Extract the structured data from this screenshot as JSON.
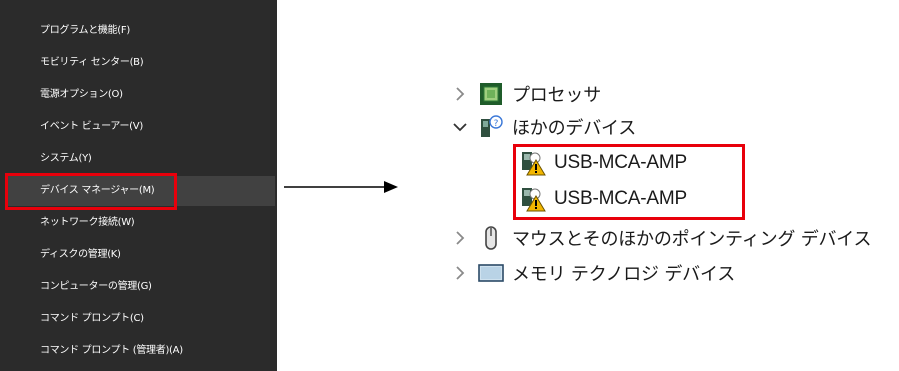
{
  "context_menu": {
    "items": [
      {
        "label": "プログラムと機能(F)"
      },
      {
        "label": "モビリティ センター(B)"
      },
      {
        "label": "電源オプション(O)"
      },
      {
        "label": "イベント ビューアー(V)"
      },
      {
        "label": "システム(Y)"
      },
      {
        "label": "デバイス マネージャー(M)"
      },
      {
        "label": "ネットワーク接続(W)"
      },
      {
        "label": "ディスクの管理(K)"
      },
      {
        "label": "コンピューターの管理(G)"
      },
      {
        "label": "コマンド プロンプト(C)"
      },
      {
        "label": "コマンド プロンプト (管理者)(A)"
      }
    ],
    "highlighted_item": "デバイス マネージャー(M)"
  },
  "device_tree": {
    "processors": {
      "label": "プロセッサ",
      "icon": "processor-icon"
    },
    "other_devices": {
      "label": "ほかのデバイス",
      "icon": "unknown-device-icon",
      "children": [
        {
          "label": "USB-MCA-AMP",
          "icon": "warning-device-icon"
        },
        {
          "label": "USB-MCA-AMP",
          "icon": "warning-device-icon"
        }
      ]
    },
    "mice": {
      "label": "マウスとそのほかのポインティング デバイス",
      "icon": "mouse-icon"
    },
    "memory": {
      "label": "メモリ テクノロジ デバイス",
      "icon": "memory-icon"
    }
  },
  "colors": {
    "menu_bg": "#2b2b2b",
    "menu_hover": "#414141",
    "highlight_box": "#e8000b"
  }
}
